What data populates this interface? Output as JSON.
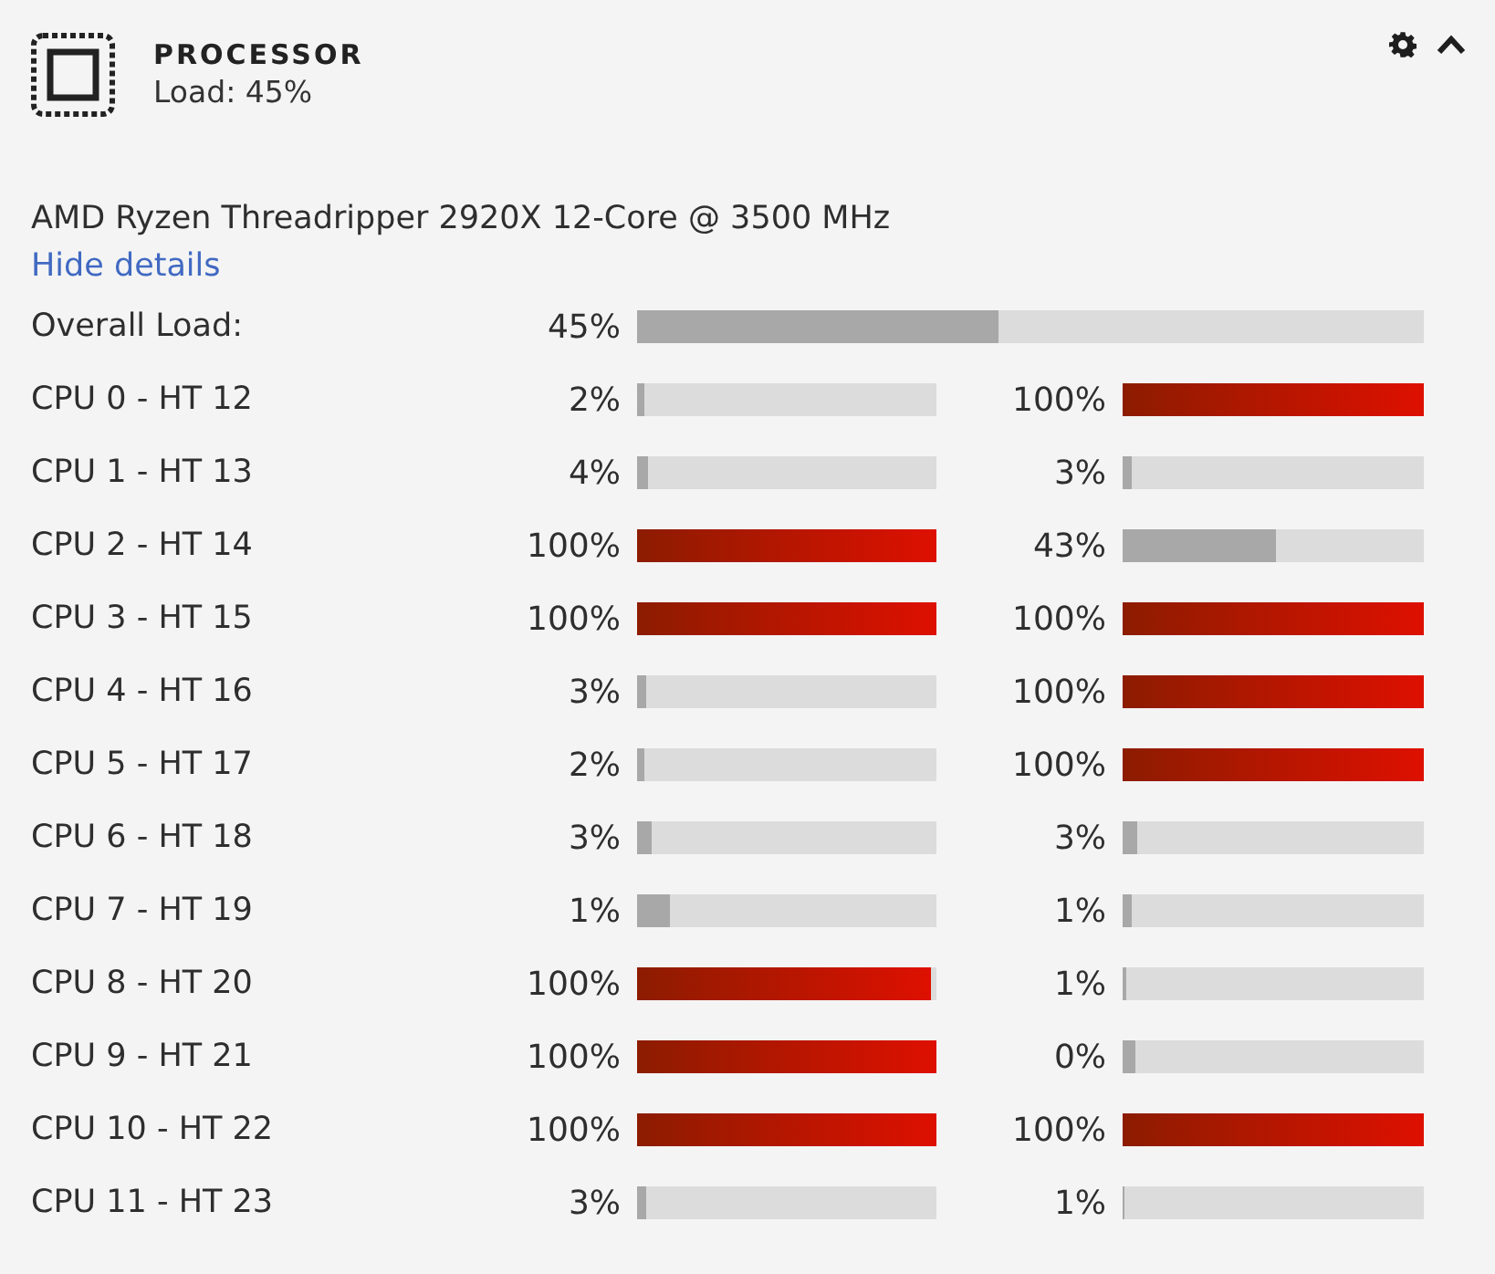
{
  "widget": {
    "title": "PROCESSOR",
    "subtitle": "Load: 45%"
  },
  "model": "AMD Ryzen Threadripper 2920X 12-Core @ 3500 MHz",
  "toggle_link": "Hide details",
  "overall": {
    "label": "Overall Load:",
    "reading": "45%",
    "level": 0.46
  },
  "cores": [
    {
      "label": "CPU 0 - HT 12",
      "threads": [
        {
          "reading": "2%",
          "level": 0.023
        },
        {
          "reading": "100%",
          "level": 1
        }
      ]
    },
    {
      "label": "CPU 1 - HT 13",
      "threads": [
        {
          "reading": "4%",
          "level": 0.036
        },
        {
          "reading": "3%",
          "level": 0.031
        }
      ]
    },
    {
      "label": "CPU 2 - HT 14",
      "threads": [
        {
          "reading": "100%",
          "level": 1
        },
        {
          "reading": "43%",
          "level": 0.51
        }
      ]
    },
    {
      "label": "CPU 3 - HT 15",
      "threads": [
        {
          "reading": "100%",
          "level": 1
        },
        {
          "reading": "100%",
          "level": 1
        }
      ]
    },
    {
      "label": "CPU 4 - HT 16",
      "threads": [
        {
          "reading": "3%",
          "level": 0.031
        },
        {
          "reading": "100%",
          "level": 1
        }
      ]
    },
    {
      "label": "CPU 5 - HT 17",
      "threads": [
        {
          "reading": "2%",
          "level": 0.023
        },
        {
          "reading": "100%",
          "level": 1
        }
      ]
    },
    {
      "label": "CPU 6 - HT 18",
      "threads": [
        {
          "reading": "3%",
          "level": 0.048
        },
        {
          "reading": "3%",
          "level": 0.048
        }
      ]
    },
    {
      "label": "CPU 7 - HT 19",
      "threads": [
        {
          "reading": "1%",
          "level": 0.109
        },
        {
          "reading": "1%",
          "level": 0.031
        }
      ]
    },
    {
      "label": "CPU 8 - HT 20",
      "threads": [
        {
          "reading": "100%",
          "level": 0.98
        },
        {
          "reading": "1%",
          "level": 0.01
        }
      ]
    },
    {
      "label": "CPU 9 - HT 21",
      "threads": [
        {
          "reading": "100%",
          "level": 1
        },
        {
          "reading": "0%",
          "level": 0.042
        }
      ]
    },
    {
      "label": "CPU 10 - HT 22",
      "threads": [
        {
          "reading": "100%",
          "level": 1
        },
        {
          "reading": "100%",
          "level": 1
        }
      ]
    },
    {
      "label": "CPU 11 - HT 23",
      "threads": [
        {
          "reading": "3%",
          "level": 0.031
        },
        {
          "reading": "1%",
          "level": 0.008
        }
      ]
    }
  ]
}
